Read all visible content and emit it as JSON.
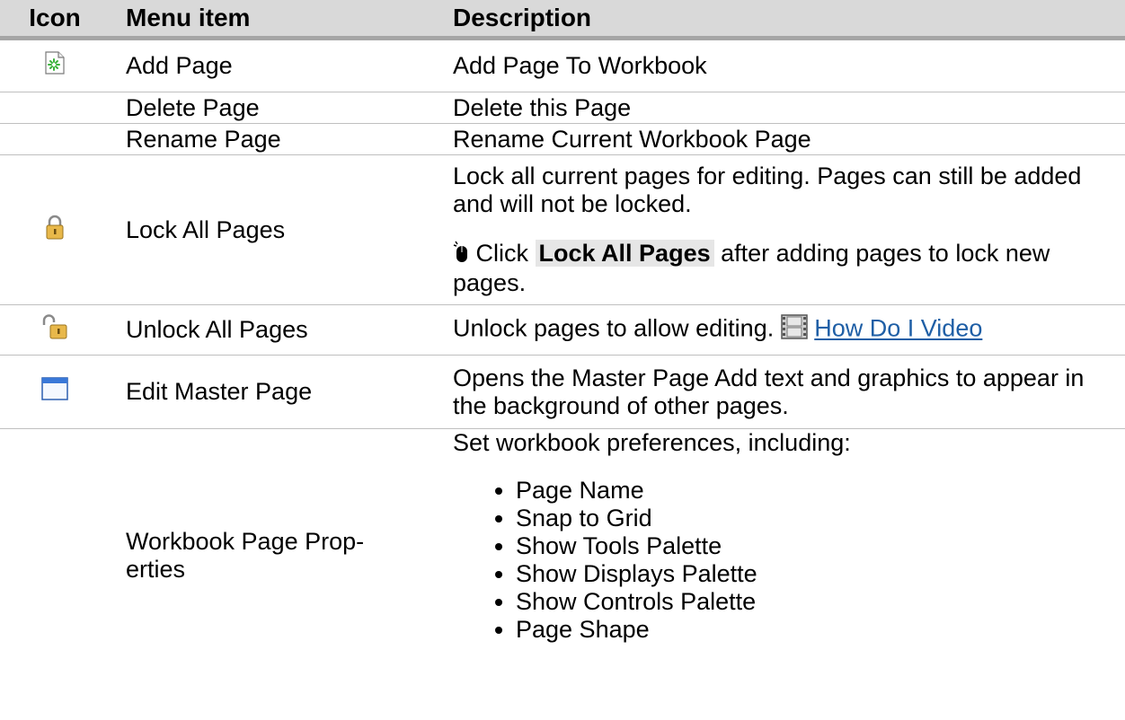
{
  "table": {
    "headers": {
      "icon": "Icon",
      "item": "Menu item",
      "description": "Description"
    },
    "rows": [
      {
        "icon": "add-page-icon",
        "item": "Add Page",
        "description": "Add Page To Workbook"
      },
      {
        "icon": "",
        "item": "Delete Page",
        "description": "Delete this Page"
      },
      {
        "icon": "",
        "item": "Rename Page",
        "description": "Rename Current Workbook Page"
      },
      {
        "icon": "lock-icon",
        "item": "Lock All Pages",
        "description": "Lock all current pages for editing. Pages can still be added and will not be locked.",
        "note_prefix": "Click",
        "note_bold": "Lock All Pages",
        "note_suffix": "after adding pages to lock new pages.",
        "note_icon": "mouse-icon"
      },
      {
        "icon": "unlock-icon",
        "item": "Unlock All Pages",
        "description": "Unlock pages to allow editing.",
        "link_icon": "film-icon",
        "link_text": "How Do I Video"
      },
      {
        "icon": "master-page-icon",
        "item": "Edit Master Page",
        "description": "Opens the Master Page Add text and graphics to appear in the background of other pages."
      },
      {
        "icon": "",
        "item": "Workbook Page Prop-\nerties",
        "description": "Set workbook preferences, including:",
        "list": [
          "Page Name",
          "Snap to Grid",
          "Show Tools Palette",
          "Show Displays Palette",
          "Show Controls Palette",
          "Page Shape"
        ]
      }
    ]
  }
}
